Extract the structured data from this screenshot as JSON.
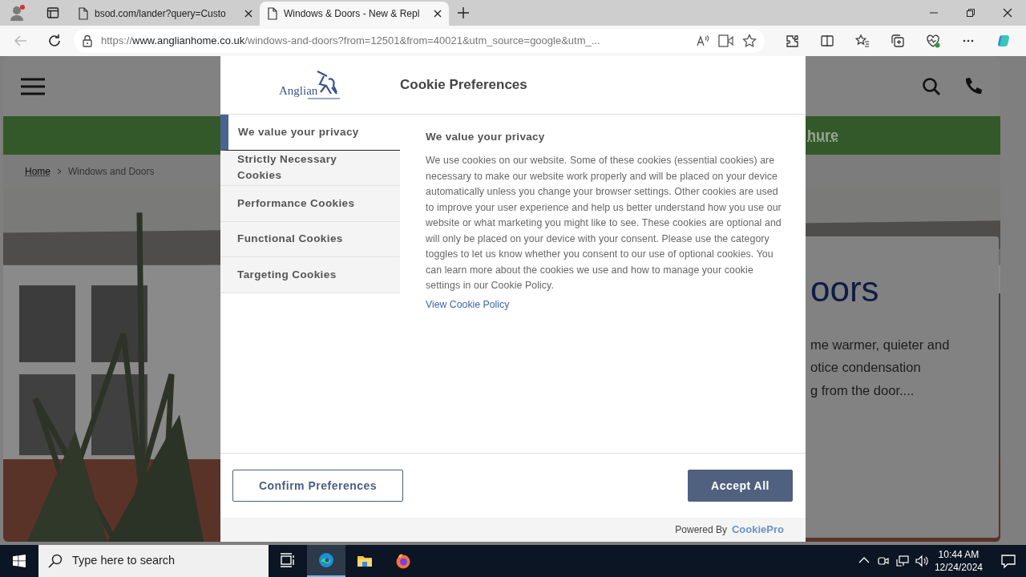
{
  "browser": {
    "tabs": [
      {
        "title": "bsod.com/lander?query=Custo",
        "selected": false
      },
      {
        "title": "Windows & Doors - New & Repl",
        "selected": true
      }
    ],
    "url": {
      "scheme": "https://",
      "host": "www.anglianhome.co.uk",
      "path": "/windows-and-doors?from=12501&from=40021&utm_source=google&utm_..."
    }
  },
  "site": {
    "banner_link": "hure",
    "breadcrumb": [
      {
        "label": "Home",
        "link": true
      },
      {
        "label": "Windows and Doors",
        "link": false
      }
    ],
    "hero": {
      "heading": "oors",
      "lines": [
        "me warmer, quieter and",
        "otice condensation",
        "g from the door...."
      ]
    }
  },
  "cookie_dialog": {
    "logo_text": "Anglian",
    "title": "Cookie Preferences",
    "nav": [
      {
        "label": "We value your privacy",
        "selected": true
      },
      {
        "label": "Strictly Necessary Cookies",
        "selected": false
      },
      {
        "label": "Performance Cookies",
        "selected": false
      },
      {
        "label": "Functional Cookies",
        "selected": false
      },
      {
        "label": "Targeting Cookies",
        "selected": false
      }
    ],
    "heading": "We value your privacy",
    "body": "We use cookies on our website. Some of these cookies (essential cookies) are necessary to make our website work properly and will be placed on your device automatically unless you change your browser settings. Other cookies are used to improve your user experience and help us better understand how you use our website or what marketing you might like to see. These cookies are optional and will only be placed on your device with your consent. Please use the category toggles to let us know whether you consent to our use of optional cookies. You can learn more about the cookies we use and how to manage your cookie settings in our Cookie Policy.",
    "policy_link": "View Cookie Policy",
    "buttons": [
      {
        "label": "Confirm Preferences",
        "kind": "outline"
      },
      {
        "label": "Accept All",
        "kind": "filled"
      }
    ],
    "powered_by": "Powered By",
    "brand": "CookiePro"
  },
  "taskbar": {
    "search_placeholder": "Type here to search",
    "apps": [
      {
        "kind": "taskview",
        "selected": false
      },
      {
        "kind": "edge",
        "selected": true
      },
      {
        "kind": "files",
        "selected": false
      },
      {
        "kind": "firefox",
        "selected": false
      }
    ],
    "time": "10:44 AM",
    "date": "12/24/2024"
  }
}
